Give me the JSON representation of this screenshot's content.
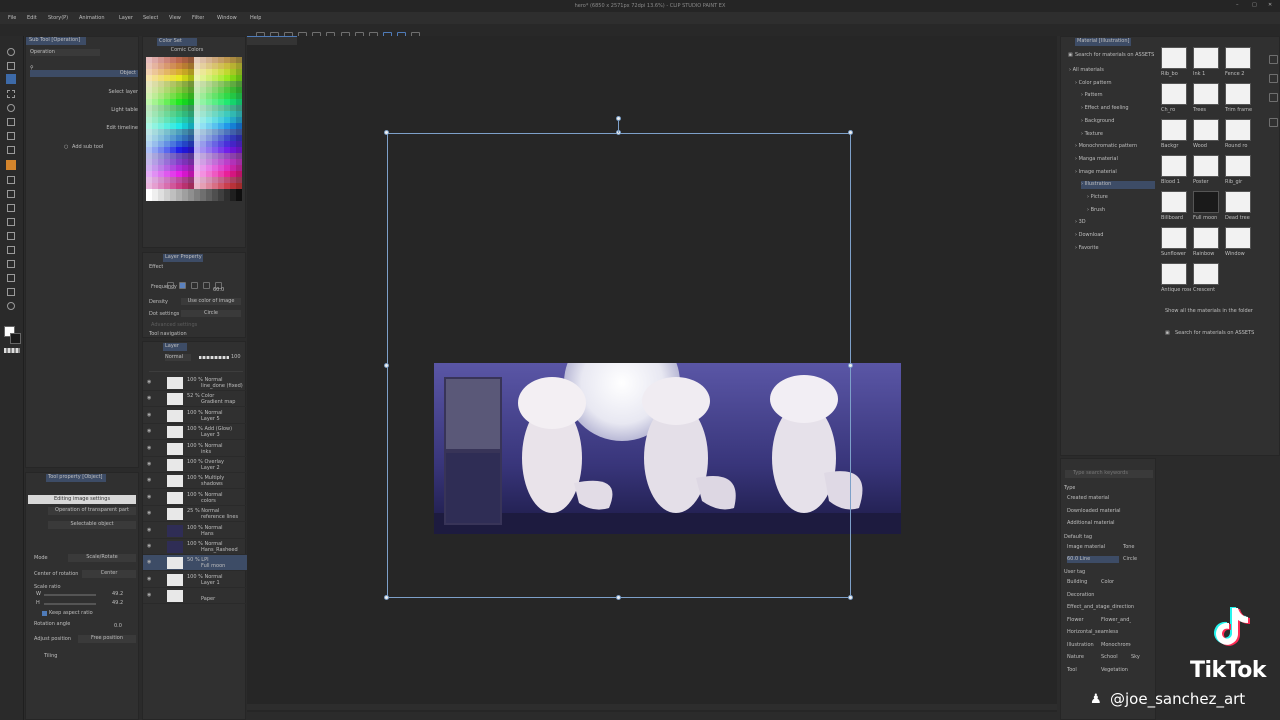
{
  "app": {
    "title": "hero* (6850 x 2571px 72dpi 13.6%) - CLIP STUDIO PAINT EX",
    "menu": [
      "File",
      "Edit",
      "Story(P)",
      "Animation",
      "Layer",
      "Select",
      "View",
      "Filter",
      "Window",
      "Help"
    ]
  },
  "subtool": {
    "tab": "Sub Tool [Operation]",
    "items": [
      {
        "label": "Operation",
        "right": ""
      },
      {
        "label": "",
        "right": "Object"
      },
      {
        "label": "",
        "right": "Select layer"
      },
      {
        "label": "",
        "right": "Light table"
      },
      {
        "label": "",
        "right": "Edit timeline"
      }
    ],
    "add_label": "Add sub tool"
  },
  "colorset": {
    "tab": "Color Set",
    "name": "Comic Colors"
  },
  "layerprop": {
    "tab": "Layer Property",
    "effect": "Effect",
    "frequency_label": "Frequency",
    "frequency_value": "60.0",
    "density_label": "Density",
    "density_value": "Use color of image",
    "dot_label": "Dot settings",
    "dot_value": "Circle",
    "adv": "Advanced settings",
    "tool_nav": "Tool navigation"
  },
  "layer": {
    "tab": "Layer",
    "blend": "Normal",
    "opacity": "100",
    "rows": [
      {
        "a": "100 % Normal",
        "b": "line_done (fixed)"
      },
      {
        "a": "52 % Color",
        "b": "Gradient map"
      },
      {
        "a": "100 % Normal",
        "b": "Layer 5"
      },
      {
        "a": "100 % Add (Glow)",
        "b": "Layer 3"
      },
      {
        "a": "100 % Normal",
        "b": "inks"
      },
      {
        "a": "100 % Overlay",
        "b": "Layer 2"
      },
      {
        "a": "100 % Multiply",
        "b": "shadows"
      },
      {
        "a": "100 % Normal",
        "b": "colors"
      },
      {
        "a": "25 % Normal",
        "b": "reference lines"
      },
      {
        "a": "100 % Normal",
        "b": "Hans"
      },
      {
        "a": "100 % Normal",
        "b": "Hans_Rasheed"
      },
      {
        "a": "50 % LPI",
        "b": "Full moon"
      },
      {
        "a": "100 % Normal",
        "b": "Layer 1"
      },
      {
        "a": "",
        "b": "Paper"
      }
    ]
  },
  "toolprop": {
    "tab": "Tool property [Object]",
    "edit_btn": "Editing image settings",
    "operation_target": "Operation of transparent part",
    "selectable": "Selectable object",
    "mode_label": "Mode",
    "mode_value": "Scale/Rotate",
    "center_label": "Center of rotation",
    "center_value": "Center",
    "scale_label": "Scale ratio",
    "w_label": "W",
    "w_value": "49.2",
    "h_label": "H",
    "h_value": "49.2",
    "keep_aspect": "Keep aspect ratio",
    "rot_label": "Rotation angle",
    "rot_value": "0.0",
    "adjust_label": "Adjust position",
    "adjust_value": "Free position",
    "tiling": "Tiling"
  },
  "material": {
    "tab": "Material [Illustration]",
    "search_assets": "Search for materials on ASSETS",
    "tree": [
      {
        "label": "All materials",
        "level": 0
      },
      {
        "label": "Color pattern",
        "level": 1
      },
      {
        "label": "Pattern",
        "level": 2
      },
      {
        "label": "Effect and feeling",
        "level": 2
      },
      {
        "label": "Background",
        "level": 2
      },
      {
        "label": "Texture",
        "level": 2
      },
      {
        "label": "Monochromatic pattern",
        "level": 1
      },
      {
        "label": "Manga material",
        "level": 1
      },
      {
        "label": "Image material",
        "level": 1
      },
      {
        "label": "Illustration",
        "level": 2
      },
      {
        "label": "Picture",
        "level": 3
      },
      {
        "label": "Brush",
        "level": 3
      },
      {
        "label": "3D",
        "level": 1
      },
      {
        "label": "Download",
        "level": 1
      },
      {
        "label": "Favorite",
        "level": 1
      }
    ],
    "thumbs": [
      "Rib_bo",
      "Ink 1",
      "Fence 2",
      "Ch_ro",
      "Trees",
      "Trim frame",
      "Backgr",
      "Wood",
      "Round ro",
      "Blood 1",
      "Poster",
      "Rib_gir",
      "Billboard",
      "Full moon",
      "Dead tree",
      "Sunflower",
      "Rainbow",
      "Window",
      "Antique rose",
      "Crescent"
    ],
    "show_all": "Show all the materials in the folder",
    "search_assets2": "Search for materials on ASSETS",
    "search_placeholder": "Type search keywords",
    "type_label": "Type",
    "types": [
      "Created material",
      "Downloaded material",
      "Additional material"
    ],
    "default_tag": "Default tag",
    "default_tags": [
      "Image material",
      "Tone",
      "60.0 Line",
      "Circle"
    ],
    "user_tag": "User tag",
    "user_tags": [
      "Building",
      "Color",
      "Decoration",
      "Effect_and_stage_direction",
      "Flower",
      "Flower_and_plant",
      "Horizontal_seamless",
      "Illustration",
      "Monochrome",
      "Nature",
      "School",
      "Sky",
      "Tool",
      "Vegetation"
    ]
  },
  "watermark": {
    "brand": "TikTok",
    "handle": "@joe_sanchez_art"
  },
  "colors": {
    "accent": "#3d6aa8",
    "panel": "#303030",
    "bg": "#2b2b2b"
  }
}
